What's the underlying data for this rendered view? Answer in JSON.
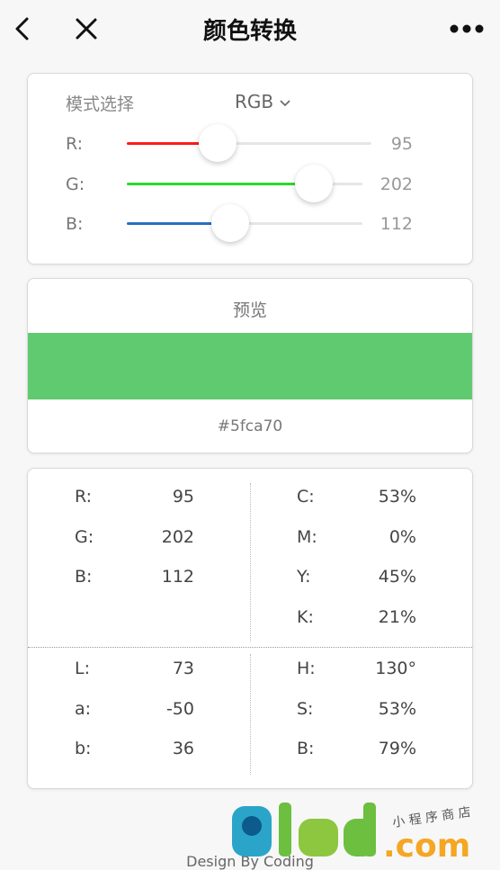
{
  "header": {
    "title": "颜色转换"
  },
  "mode": {
    "label": "模式选择",
    "selected": "RGB"
  },
  "sliders": [
    {
      "label": "R:",
      "value": "95",
      "level": 0.373,
      "color": "#ff1a1a"
    },
    {
      "label": "G:",
      "value": "202",
      "level": 0.792,
      "color": "#2cd92c"
    },
    {
      "label": "B:",
      "value": "112",
      "level": 0.439,
      "color": "#2a6fbf"
    }
  ],
  "preview": {
    "title": "预览",
    "hex": "#5fca70",
    "color": "#5fca70"
  },
  "values": {
    "rgb": [
      {
        "k": "R:",
        "v": "95"
      },
      {
        "k": "G:",
        "v": "202"
      },
      {
        "k": "B:",
        "v": "112"
      }
    ],
    "cmyk": [
      {
        "k": "C:",
        "v": "53%"
      },
      {
        "k": "M:",
        "v": "0%"
      },
      {
        "k": "Y:",
        "v": "45%"
      },
      {
        "k": "K:",
        "v": "21%"
      }
    ],
    "lab": [
      {
        "k": "L:",
        "v": "73"
      },
      {
        "k": "a:",
        "v": "-50"
      },
      {
        "k": "b:",
        "v": "36"
      }
    ],
    "hsb": [
      {
        "k": "H:",
        "v": "130°"
      },
      {
        "k": "S:",
        "v": "53%"
      },
      {
        "k": "B:",
        "v": "79%"
      }
    ]
  },
  "footer": {
    "text": "Design By Coding"
  },
  "watermark": {
    "text": "91ud.com",
    "tagline": "小程序商店"
  }
}
